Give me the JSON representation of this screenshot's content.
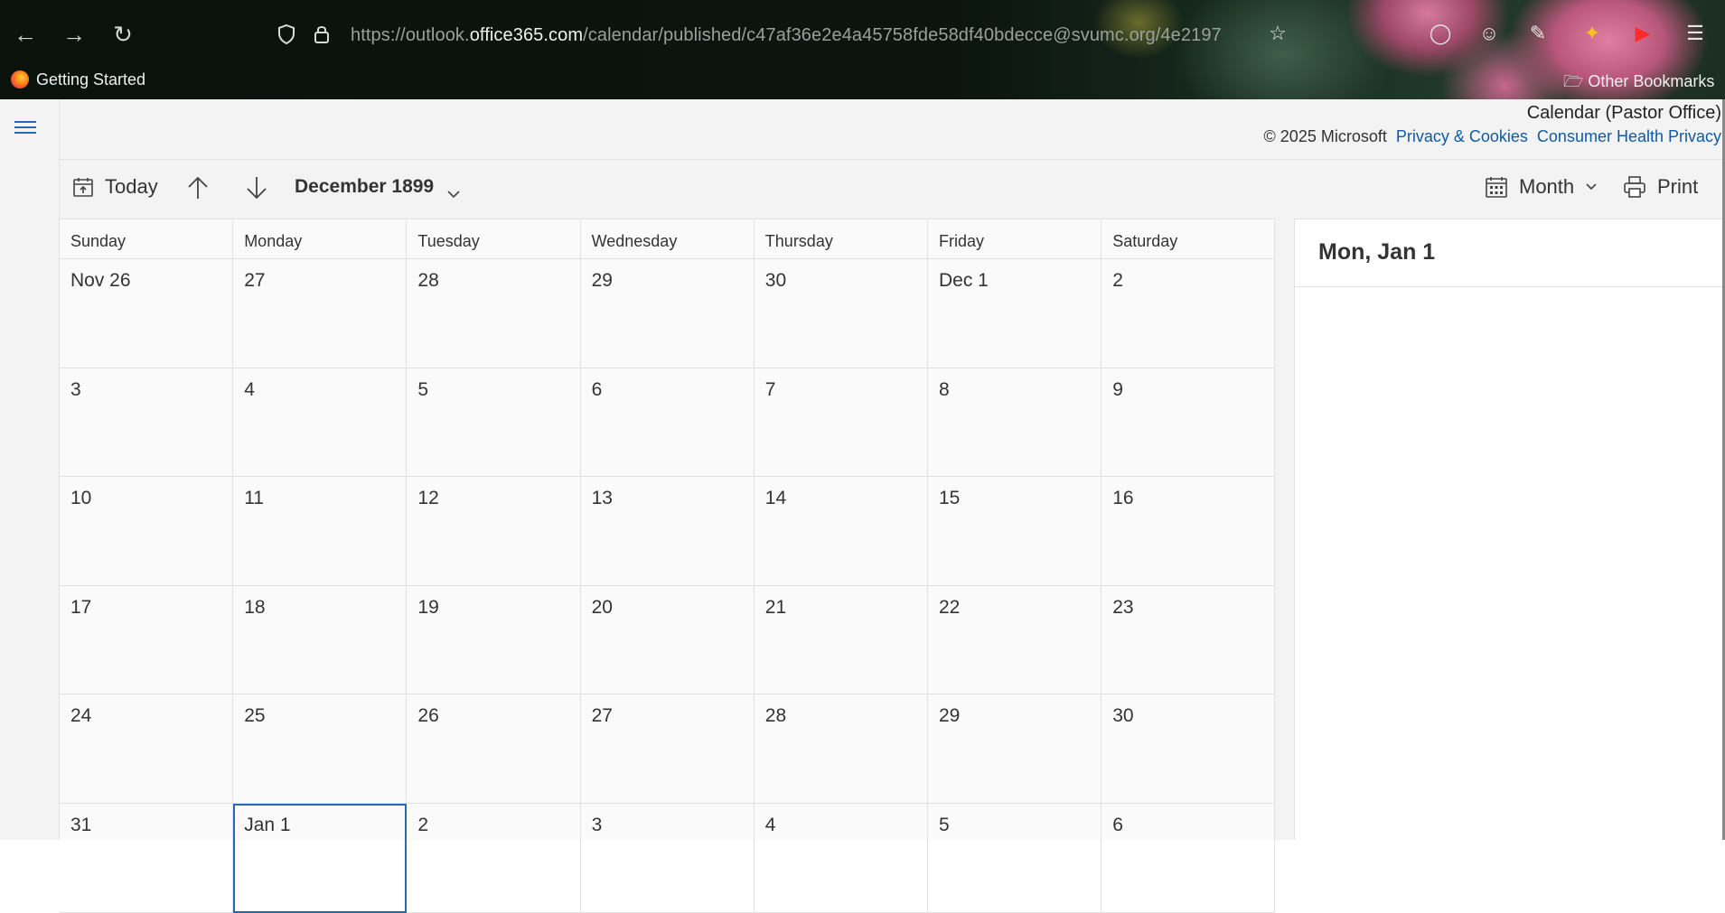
{
  "browser": {
    "url_prefix": "https://outlook.",
    "url_domain": "office365.com",
    "url_path": "/calendar/published/c47af36e2e4a45758fde58df40bdecce@svumc.org/4e2197",
    "bookmark_getting_started": "Getting Started",
    "bookmark_other": "Other Bookmarks"
  },
  "header": {
    "calendar_title": "Calendar (Pastor Office)",
    "copyright": "© 2025 Microsoft",
    "privacy_link": "Privacy & Cookies",
    "health_link": "Consumer Health Privacy"
  },
  "toolbar": {
    "today": "Today",
    "month_label": "December 1899",
    "view": "Month",
    "print": "Print"
  },
  "weekdays": [
    "Sunday",
    "Monday",
    "Tuesday",
    "Wednesday",
    "Thursday",
    "Friday",
    "Saturday"
  ],
  "weeks": [
    [
      "Nov 26",
      "27",
      "28",
      "29",
      "30",
      "Dec 1",
      "2"
    ],
    [
      "3",
      "4",
      "5",
      "6",
      "7",
      "8",
      "9"
    ],
    [
      "10",
      "11",
      "12",
      "13",
      "14",
      "15",
      "16"
    ],
    [
      "17",
      "18",
      "19",
      "20",
      "21",
      "22",
      "23"
    ],
    [
      "24",
      "25",
      "26",
      "27",
      "28",
      "29",
      "30"
    ],
    [
      "31",
      "Jan 1",
      "2",
      "3",
      "4",
      "5",
      "6"
    ]
  ],
  "selected_cell": {
    "week": 5,
    "day": 1
  },
  "panel": {
    "title": "Mon, Jan 1"
  },
  "colors": {
    "accent": "#2b66b5",
    "link": "#0f5aa8"
  }
}
